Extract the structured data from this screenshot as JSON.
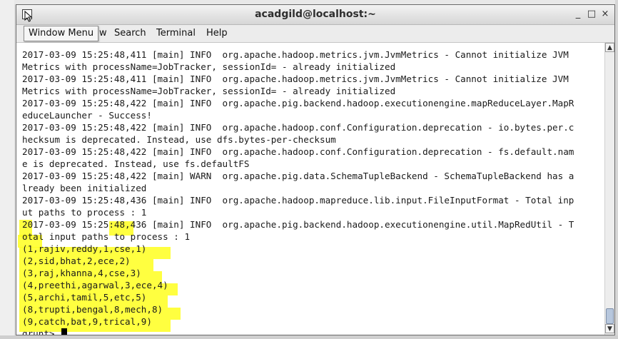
{
  "window": {
    "title": "acadgild@localhost:~",
    "minimize_glyph": "_",
    "maximize_glyph": "□",
    "close_glyph": "×"
  },
  "menu": {
    "tooltip": "Window Menu",
    "items": [
      "w",
      "Search",
      "Terminal",
      "Help"
    ]
  },
  "terminal": {
    "lines": [
      "2017-03-09 15:25:48,411 [main] INFO  org.apache.hadoop.metrics.jvm.JvmMetrics - Cannot initialize JVM",
      "Metrics with processName=JobTracker, sessionId= - already initialized",
      "2017-03-09 15:25:48,411 [main] INFO  org.apache.hadoop.metrics.jvm.JvmMetrics - Cannot initialize JVM",
      "Metrics with processName=JobTracker, sessionId= - already initialized",
      "2017-03-09 15:25:48,422 [main] INFO  org.apache.pig.backend.hadoop.executionengine.mapReduceLayer.MapR",
      "educeLauncher - Success!",
      "2017-03-09 15:25:48,422 [main] INFO  org.apache.hadoop.conf.Configuration.deprecation - io.bytes.per.c",
      "hecksum is deprecated. Instead, use dfs.bytes-per-checksum",
      "2017-03-09 15:25:48,422 [main] INFO  org.apache.hadoop.conf.Configuration.deprecation - fs.default.nam",
      "e is deprecated. Instead, use fs.defaultFS",
      "2017-03-09 15:25:48,422 [main] WARN  org.apache.pig.data.SchemaTupleBackend - SchemaTupleBackend has a",
      "lready been initialized",
      "2017-03-09 15:25:48,436 [main] INFO  org.apache.hadoop.mapreduce.lib.input.FileInputFormat - Total inp",
      "ut paths to process : 1",
      "2017-03-09 15:25:48,436 [main] INFO  org.apache.pig.backend.hadoop.executionengine.util.MapRedUtil - T",
      "otal input paths to process : 1",
      "(1,rajiv,reddy,1,cse,1)",
      "(2,sid,bhat,2,ece,2)",
      "(3,raj,khanna,4,cse,3)",
      "(4,preethi,agarwal,3,ece,4)",
      "(5,archi,tamil,5,etc,5)",
      "(8,trupti,bengal,8,mech,8)",
      "(9,catch,bat,9,trical,9)"
    ],
    "prompt": "grunt> "
  },
  "scrollbar": {
    "up_glyph": "▲",
    "down_glyph": "▼"
  },
  "colors": {
    "highlight": "#ffff1e",
    "text": "#1a1a1a",
    "background": "#ffffff"
  }
}
